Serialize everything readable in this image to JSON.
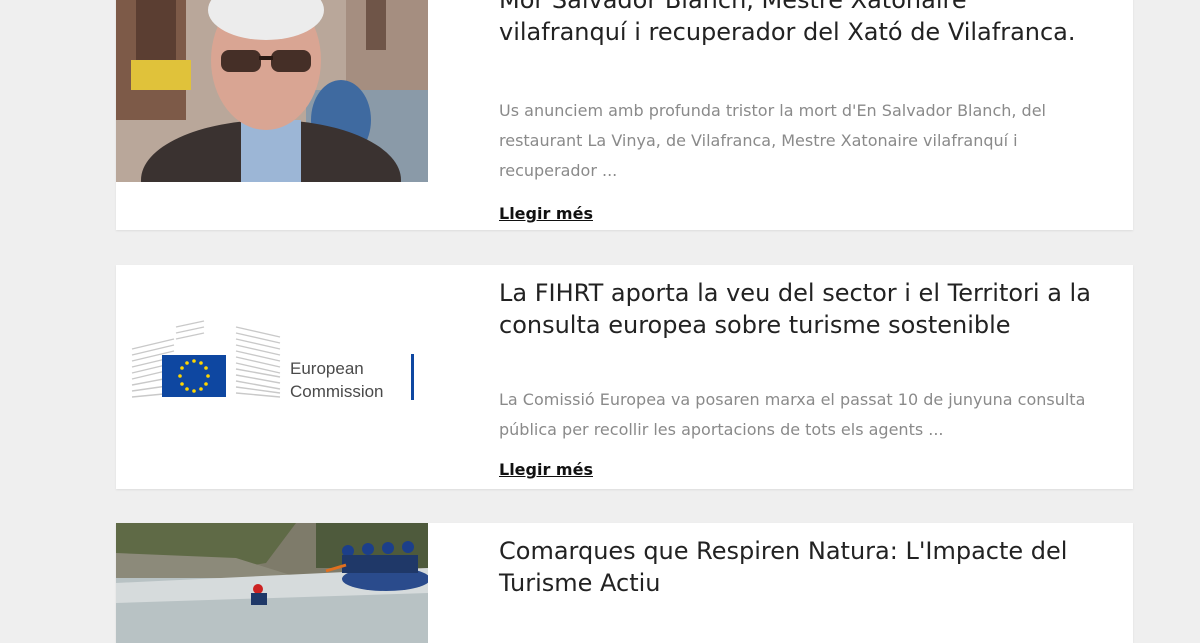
{
  "articles": [
    {
      "title": "Mor Salvador Blanch, Mestre Xatonaire vilafranquí i recuperador del Xató de Vilafranca.",
      "excerpt": "Us anunciem amb profunda tristor la mort d'En Salvador Blanch, del restaurant La Vinya, de Vilafranca, Mestre Xatonaire vilafranquí i recuperador ...",
      "more": "Llegir més",
      "image": "portrait-photo"
    },
    {
      "title": "La FIHRT aporta la veu del sector i el Territori a la consulta europea sobre turisme sostenible",
      "excerpt": "La Comissió Europea va posaren marxa el passat 10 de junyuna consulta pública per recollir les aportacions de tots els agents ...",
      "more": "Llegir més",
      "image": "european-commission-logo",
      "logo_text": "European Commission"
    },
    {
      "title": "Comarques que Respiren Natura: L'Impacte del Turisme Actiu",
      "image": "rafting-photo"
    }
  ],
  "colors": {
    "background": "#efefef",
    "card": "#ffffff",
    "title": "#222222",
    "excerpt": "#8a8a8a",
    "eu_blue": "#0e47a1",
    "eu_yellow": "#ffd600"
  }
}
